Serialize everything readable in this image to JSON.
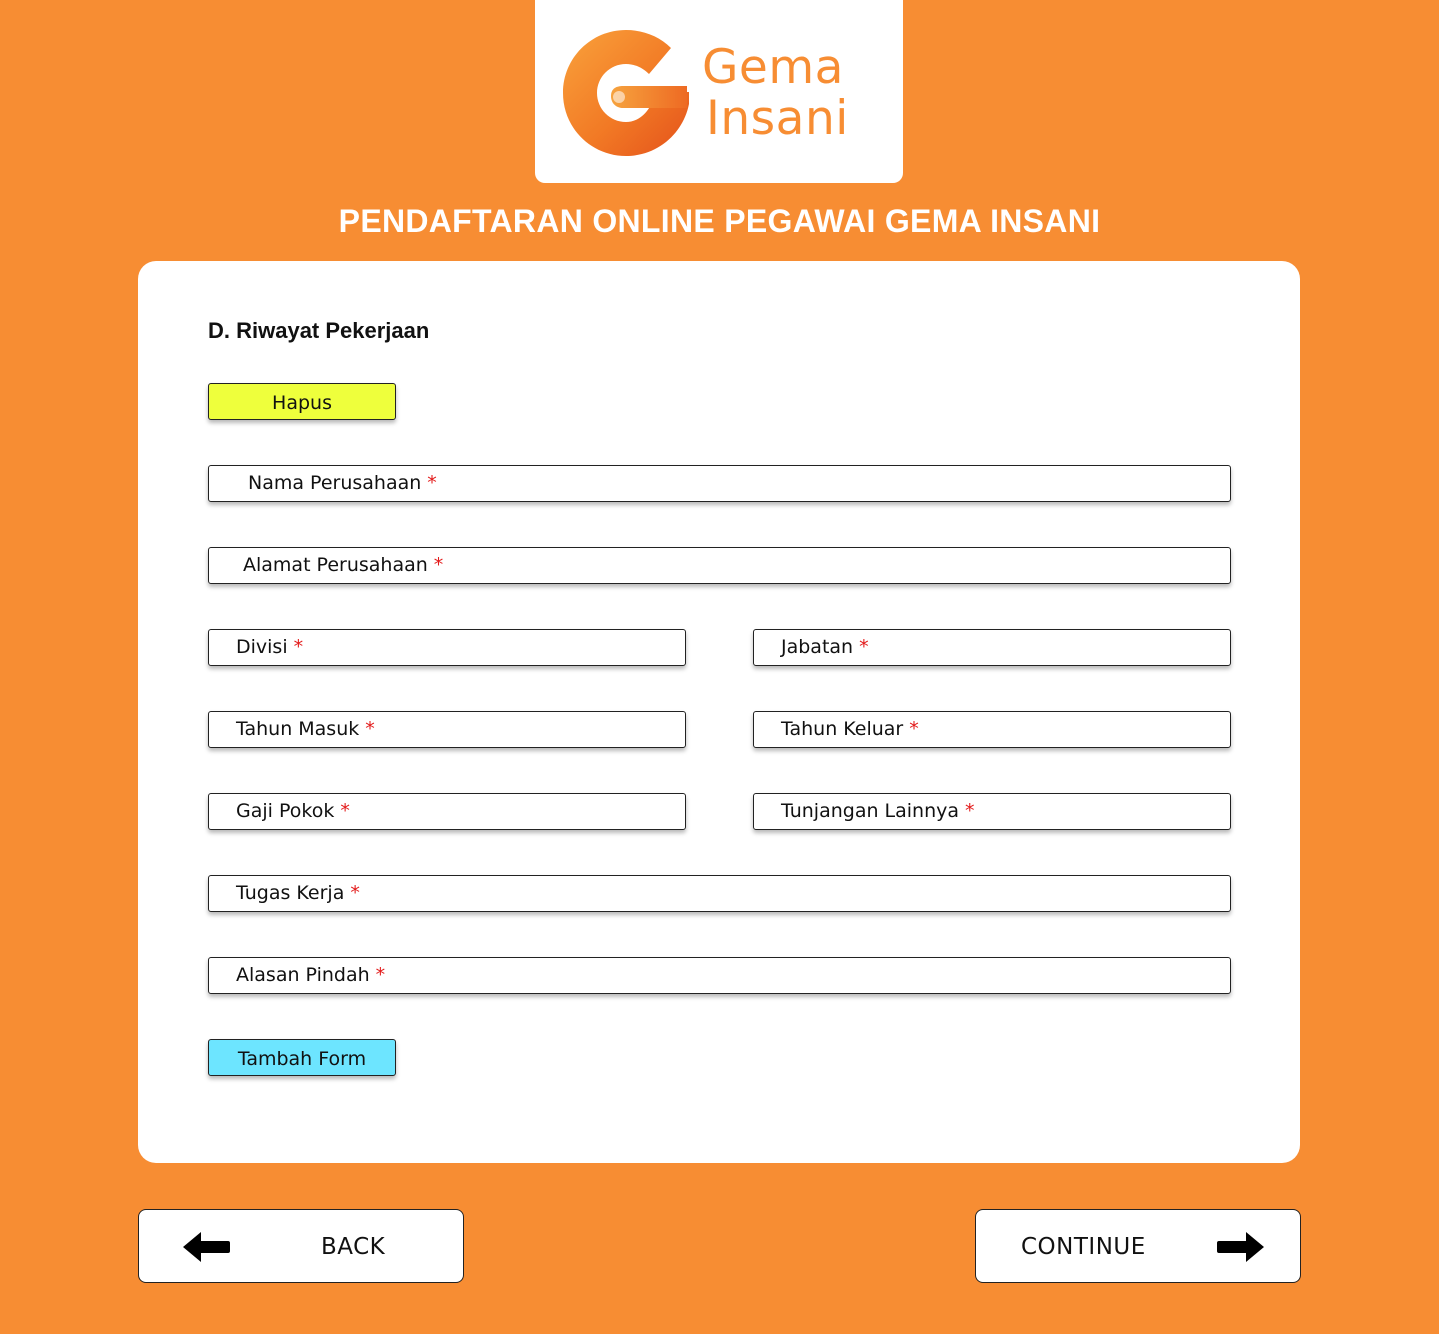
{
  "brand": {
    "name_line1": "Gema",
    "name_line2": "Insani",
    "logo_icon": "g-logo-icon",
    "brand_color": "#F78D33"
  },
  "page": {
    "title": "PENDAFTARAN ONLINE PEGAWAI GEMA INSANI",
    "background_color": "#F78D33"
  },
  "section": {
    "title": "D. Riwayat Pekerjaan",
    "delete_button": {
      "label": "Hapus",
      "color": "#EEFF3C"
    },
    "add_form_button": {
      "label": "Tambah Form",
      "color": "#6DE5FF"
    }
  },
  "form": {
    "required_marker": "*",
    "required_color": "#E31B1B",
    "fields": {
      "nama_perusahaan": {
        "label": "Nama Perusahaan"
      },
      "alamat_perusahaan": {
        "label": "Alamat Perusahaan"
      },
      "divisi": {
        "label": "Divisi"
      },
      "jabatan": {
        "label": "Jabatan"
      },
      "tahun_masuk": {
        "label": "Tahun Masuk"
      },
      "tahun_keluar": {
        "label": "Tahun Keluar"
      },
      "gaji_pokok": {
        "label": "Gaji Pokok"
      },
      "tunjangan_lainnya": {
        "label": "Tunjangan Lainnya"
      },
      "tugas_kerja": {
        "label": "Tugas Kerja"
      },
      "alasan_pindah": {
        "label": "Alasan Pindah"
      }
    }
  },
  "navigation": {
    "back": {
      "label": "BACK",
      "icon": "arrow-left-icon"
    },
    "continue": {
      "label": "CONTINUE",
      "icon": "arrow-right-icon"
    }
  }
}
